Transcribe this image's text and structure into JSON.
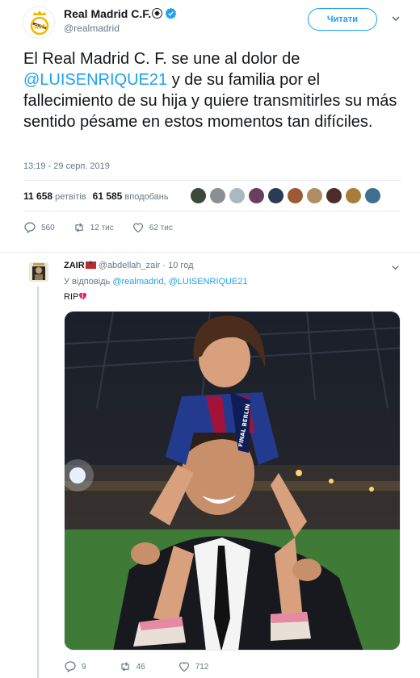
{
  "tweet": {
    "author_name": "Real Madrid C.F.",
    "author_handle": "@realmadrid",
    "follow_label": "Читати",
    "text_before": "El Real Madrid C. F. se une al dolor de ",
    "mention": "@LUISENRIQUE21",
    "text_after": " y de su familia por el fallecimiento de su hija y quiere transmitirles su más sentido pésame en estos momentos tan difíciles.",
    "timestamp": "13:19 - 29 серп. 2019",
    "retweets_count": "11 658",
    "retweets_label": "ретвітів",
    "likes_count": "61 585",
    "likes_label": "вподобань",
    "likers": [
      "#3b4a3c",
      "#8a8f95",
      "#aab8c2",
      "#6b3d5e",
      "#2a3b55",
      "#9b5a34",
      "#b08d62",
      "#4b2d2a",
      "#a87c3a",
      "#3f6f8f"
    ],
    "actions": {
      "replies": "560",
      "retweets": "12 тис",
      "likes": "62 тис"
    }
  },
  "reply": {
    "author_name": "ZAIR",
    "author_handle": "@abdellah_zair",
    "time": "· 10 год",
    "reply_to_label": "У відповідь",
    "reply_to_1": "@realmadrid",
    "reply_to_sep": ",",
    "reply_to_2": "@LUISENRIQUE21",
    "text": "RIP",
    "actions": {
      "replies": "9",
      "retweets": "46",
      "likes": "712"
    }
  },
  "colors": {
    "accent": "#1da1f2",
    "secondary_text": "#657786",
    "divider": "#e6ecf0"
  }
}
